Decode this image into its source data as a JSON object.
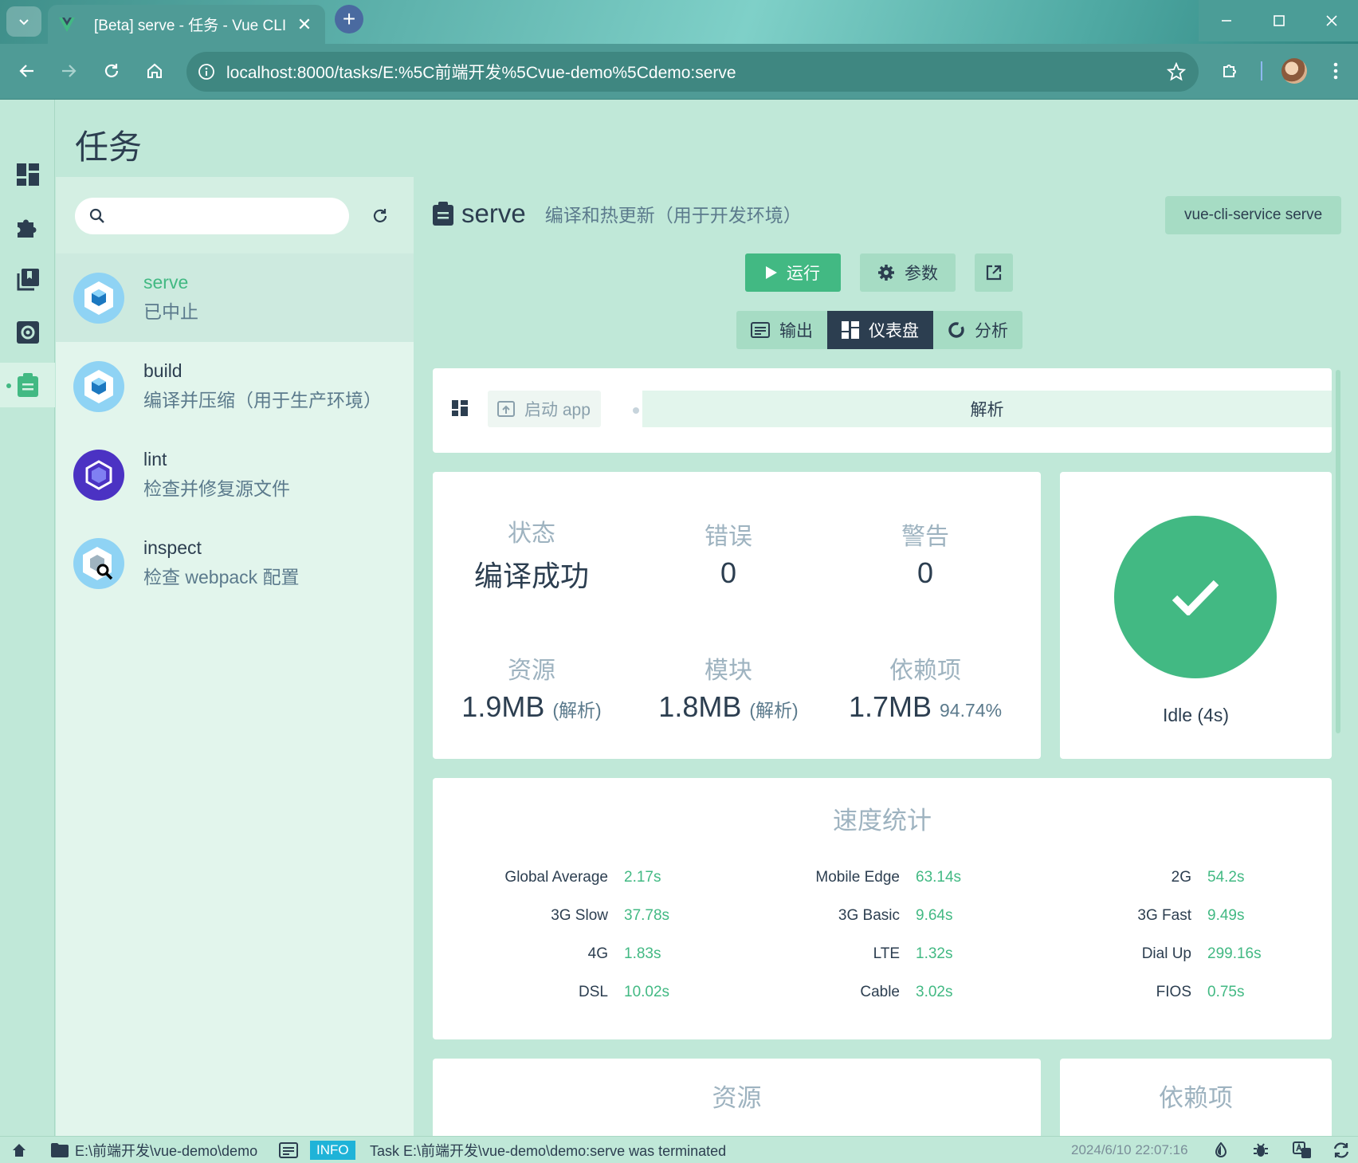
{
  "browser": {
    "tab_title": "[Beta] serve - 任务 - Vue CLI",
    "tab_close": "✕",
    "new_tab": "+",
    "url": "localhost:8000/tasks/E:%5C前端开发%5Cvue-demo%5Cdemo:serve"
  },
  "page": {
    "title": "任务"
  },
  "sidebar": {
    "search_placeholder": "",
    "tasks": [
      {
        "name": "serve",
        "desc": "已中止",
        "icon": "webpack-icon"
      },
      {
        "name": "build",
        "desc": "编译并压缩（用于生产环境）",
        "icon": "webpack-icon"
      },
      {
        "name": "lint",
        "desc": "检查并修复源文件",
        "icon": "eslint-icon"
      },
      {
        "name": "inspect",
        "desc": "检查 webpack 配置",
        "icon": "inspect-icon"
      }
    ]
  },
  "task": {
    "name": "serve",
    "desc": "编译和热更新（用于开发环境）",
    "command": "vue-cli-service serve",
    "run_label": "运行",
    "params_label": "参数",
    "tabs": [
      "输出",
      "仪表盘",
      "分析"
    ],
    "active_tab": "仪表盘"
  },
  "widgets_bar": {
    "launch_label": "启动 app",
    "analyze_label": "解析"
  },
  "stats": {
    "status": {
      "label": "状态",
      "value": "编译成功"
    },
    "errors": {
      "label": "错误",
      "value": "0"
    },
    "warnings": {
      "label": "警告",
      "value": "0"
    },
    "assets": {
      "label": "资源",
      "value": "1.9MB",
      "sub": "(解析)"
    },
    "modules": {
      "label": "模块",
      "value": "1.8MB",
      "sub": "(解析)"
    },
    "deps": {
      "label": "依赖项",
      "value": "1.7MB",
      "sub": "94.74%"
    }
  },
  "idle": {
    "text": "Idle (4s)"
  },
  "speed": {
    "title": "速度统计",
    "rows": [
      [
        {
          "k": "Global Average",
          "v": "2.17s"
        },
        {
          "k": "Mobile Edge",
          "v": "63.14s"
        },
        {
          "k": "2G",
          "v": "54.2s"
        }
      ],
      [
        {
          "k": "3G Slow",
          "v": "37.78s"
        },
        {
          "k": "3G Basic",
          "v": "9.64s"
        },
        {
          "k": "3G Fast",
          "v": "9.49s"
        }
      ],
      [
        {
          "k": "4G",
          "v": "1.83s"
        },
        {
          "k": "LTE",
          "v": "1.32s"
        },
        {
          "k": "Dial Up",
          "v": "299.16s"
        }
      ],
      [
        {
          "k": "DSL",
          "v": "10.02s"
        },
        {
          "k": "Cable",
          "v": "3.02s"
        },
        {
          "k": "FIOS",
          "v": "0.75s"
        }
      ]
    ]
  },
  "bottom": {
    "assets_title": "资源",
    "deps_title": "依赖项"
  },
  "statusbar": {
    "cwd": "E:\\前端开发\\vue-demo\\demo",
    "level": "INFO",
    "message": "Task E:\\前端开发\\vue-demo\\demo:serve was terminated",
    "time": "2024/6/10 22:07:16"
  },
  "colors": {
    "accent": "#42b983",
    "dark": "#2c3e50",
    "bg": "#c0e8d8"
  }
}
